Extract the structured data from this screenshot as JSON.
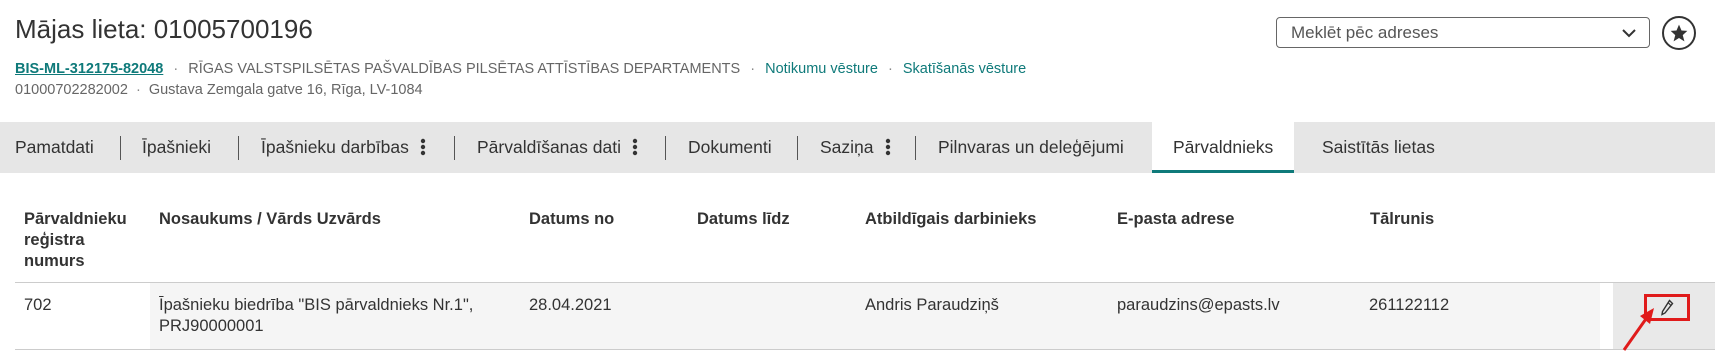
{
  "header": {
    "title": "Mājas lieta: 01005700196",
    "case_id": "BIS-ML-312175-82048",
    "department": "RĪGAS VALSTSPILSĒTAS PAŠVALDĪBAS PILSĒTAS ATTĪSTĪBAS DEPARTAMENTS",
    "link_events": "Notikumu vēsture",
    "link_views": "Skatīšanās vēsture",
    "cadastre": "01000702282002",
    "address": "Gustava Zemgala gatve 16, Rīga, LV-1084",
    "dot": "·"
  },
  "search": {
    "placeholder": "Meklēt pēc adreses",
    "icon": "chevron-down-icon"
  },
  "favorite": {
    "icon": "star-icon"
  },
  "tabs": [
    {
      "label": "Pamatdati"
    },
    {
      "label": "Īpašnieki"
    },
    {
      "label": "Īpašnieku darbības",
      "has_menu": true
    },
    {
      "label": "Pārvaldīšanas dati",
      "has_menu": true
    },
    {
      "label": "Dokumenti"
    },
    {
      "label": "Saziņa",
      "has_menu": true
    },
    {
      "label": "Pilnvaras un deleģējumi"
    },
    {
      "label": "Pārvaldnieks",
      "active": true
    },
    {
      "label": "Saistītās lietas"
    }
  ],
  "table": {
    "columns": [
      "Pārvaldnieku reģistra numurs",
      "Nosaukums / Vārds Uzvārds",
      "Datums no",
      "Datums līdz",
      "Atbildīgais darbinieks",
      "E-pasta adrese",
      "Tālrunis"
    ],
    "rows": [
      {
        "reg_no": "702",
        "name": "Īpašnieku biedrība \"BIS pārvaldnieks Nr.1\",",
        "name_line2": "PRJ90000001",
        "date_from": "28.04.2021",
        "date_to": "",
        "responsible": "Andris Paraudziņš",
        "email": "paraudzins@epasts.lv",
        "phone": "261122112"
      }
    ]
  },
  "colors": {
    "accent": "#0f7a7a",
    "highlight": "#e01b1b",
    "tab_bar": "#e6e6e6"
  }
}
